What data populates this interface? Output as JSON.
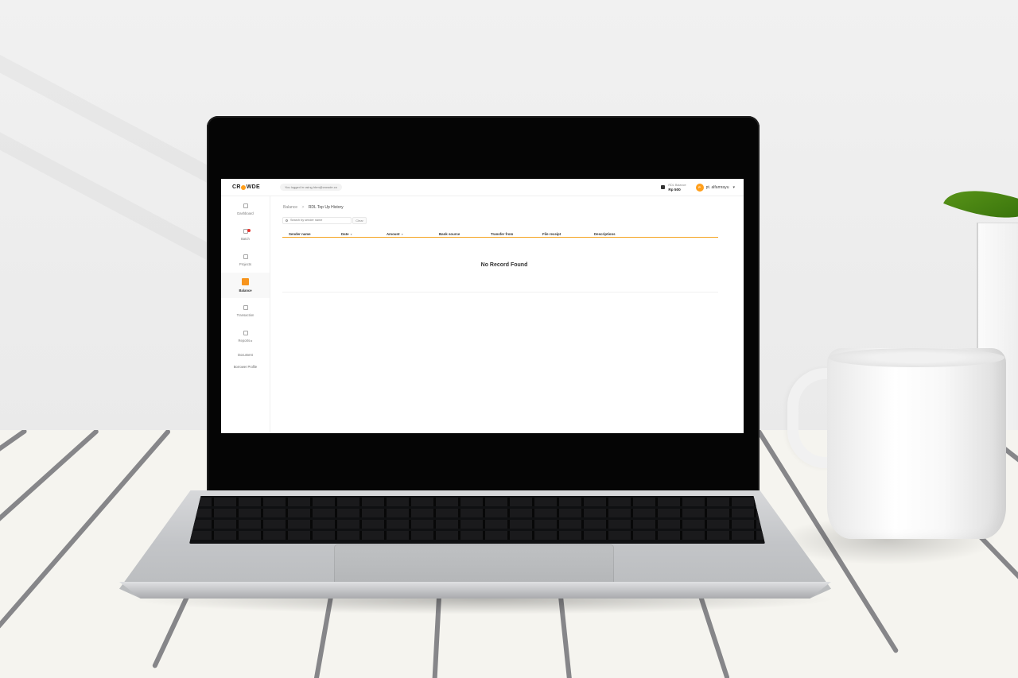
{
  "app": {
    "logo_text": [
      "CR",
      "WDE"
    ],
    "login_notice": "You logged in using hbm@crowde.co"
  },
  "topbar": {
    "balance_label": "RDL Balance",
    "balance_value": "Rp 500",
    "user_initial": "P",
    "user_name": "pt. alfamrayu"
  },
  "sidebar": {
    "items": [
      {
        "label": "Dashboard",
        "icon": "home-icon"
      },
      {
        "label": "Batch",
        "icon": "document-icon",
        "has_notification": true
      },
      {
        "label": "Projects",
        "icon": "folder-icon"
      },
      {
        "label": "Balance",
        "icon": "wallet-icon",
        "active": true
      },
      {
        "label": "Transaction",
        "icon": "transaction-icon"
      },
      {
        "label": "Reports",
        "icon": "report-icon",
        "suffix": "▸"
      }
    ],
    "links": [
      "Document",
      "Borrower Profile"
    ]
  },
  "breadcrumb": {
    "parent": "Balance",
    "separator": ">",
    "current": "RDL Top Up History"
  },
  "search": {
    "placeholder": "Search by sender name",
    "clear_label": "Clear"
  },
  "table": {
    "columns": [
      "Sender name",
      "Date",
      "Amount",
      "Bank source",
      "Transfer from",
      "File receipt",
      "Descriptions"
    ],
    "sortable_columns": [
      "Date",
      "Amount"
    ],
    "sort_icon": "▾",
    "empty_text": "No Record Found"
  },
  "colors": {
    "accent": "#f7941d",
    "notification": "#e7322d"
  }
}
